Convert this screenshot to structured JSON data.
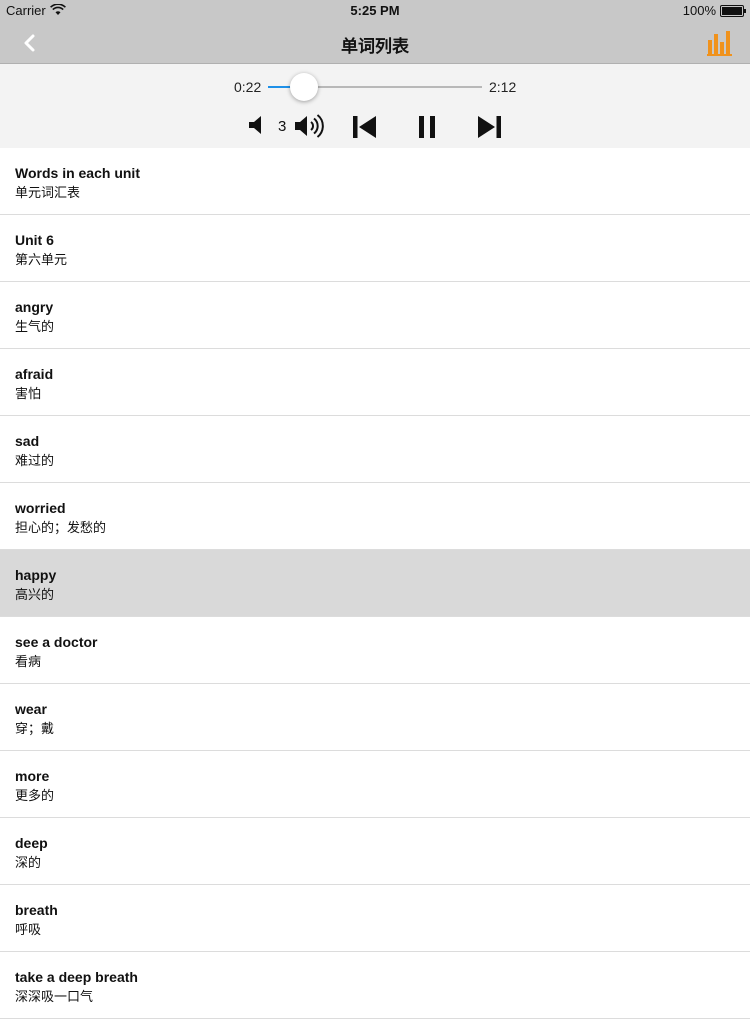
{
  "status_bar": {
    "carrier": "Carrier",
    "time": "5:25 PM",
    "battery": "100%"
  },
  "nav": {
    "title": "单词列表",
    "back_icon": "chevron-left-icon",
    "right_icon": "bar-chart-icon",
    "accent_color": "#f0921c"
  },
  "player": {
    "current_time": "0:22",
    "total_time": "2:12",
    "progress_fraction": 0.17,
    "repeat_count": "3",
    "accent_color": "#1e90e8"
  },
  "words": [
    {
      "en": "Words in each unit",
      "zh": "单元词汇表"
    },
    {
      "en": "Unit 6",
      "zh": "第六单元"
    },
    {
      "en": "angry",
      "zh": "生气的"
    },
    {
      "en": "afraid",
      "zh": "害怕"
    },
    {
      "en": "sad",
      "zh": "难过的"
    },
    {
      "en": "worried",
      "zh": "担心的；发愁的"
    },
    {
      "en": "happy",
      "zh": "高兴的",
      "selected": true
    },
    {
      "en": "see a doctor",
      "zh": "看病"
    },
    {
      "en": "wear",
      "zh": "穿；戴"
    },
    {
      "en": "more",
      "zh": "更多的"
    },
    {
      "en": "deep",
      "zh": "深的"
    },
    {
      "en": "breath",
      "zh": "呼吸"
    },
    {
      "en": "take a deep breath",
      "zh": "深深吸一口气"
    }
  ]
}
